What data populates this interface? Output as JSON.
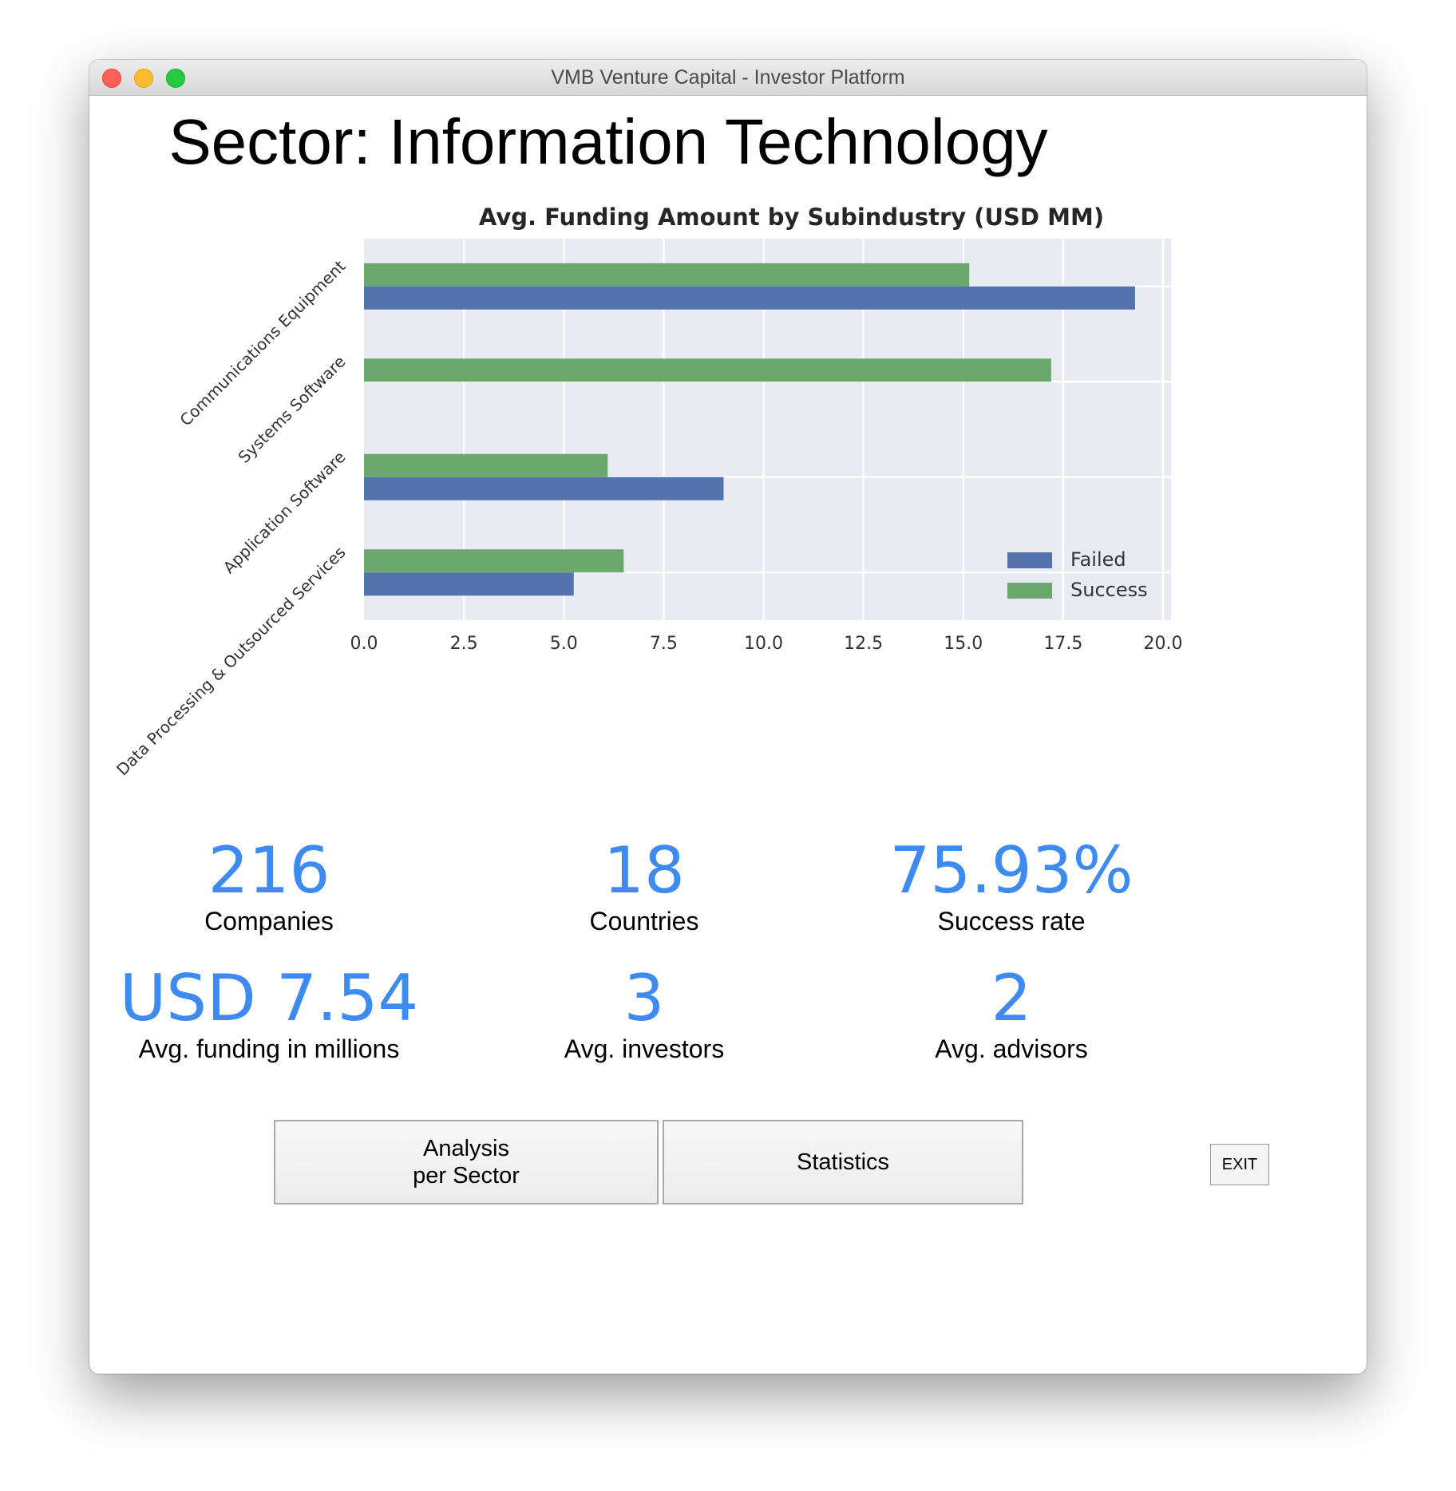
{
  "window": {
    "title": "VMB Venture Capital - Investor Platform"
  },
  "page": {
    "title": "Sector: Information Technology"
  },
  "chart_data": {
    "type": "bar",
    "orientation": "horizontal",
    "title": "Avg. Funding Amount by Subindustry (USD MM)",
    "xlabel": "",
    "ylabel": "",
    "categories": [
      "Communications Equipment",
      "Systems Software",
      "Application Software",
      "Data Processing & Outsourced Services"
    ],
    "series": [
      {
        "name": "Failed",
        "values": [
          19.3,
          0,
          9.0,
          5.25
        ],
        "color": "#5472ad"
      },
      {
        "name": "Success",
        "values": [
          15.15,
          17.2,
          6.1,
          6.5
        ],
        "color": "#6aa86e"
      }
    ],
    "xlim": [
      0,
      20.2
    ],
    "xticks": [
      "0.0",
      "2.5",
      "5.0",
      "7.5",
      "10.0",
      "12.5",
      "15.0",
      "17.5",
      "20.0"
    ],
    "grid": true,
    "legend_position": "bottom-right",
    "background": "#eaeaf2"
  },
  "metrics": [
    {
      "value": "216",
      "label": "Companies"
    },
    {
      "value": "18",
      "label": "Countries"
    },
    {
      "value": "75.93%",
      "label": "Success rate"
    },
    {
      "value": "USD 7.54",
      "label": "Avg. funding in millions"
    },
    {
      "value": "3",
      "label": "Avg. investors"
    },
    {
      "value": "2",
      "label": "Avg. advisors"
    }
  ],
  "buttons": {
    "analysis": "Analysis\nper Sector",
    "statistics": "Statistics",
    "exit": "EXIT"
  },
  "colors": {
    "accent": "#3d8af0"
  }
}
